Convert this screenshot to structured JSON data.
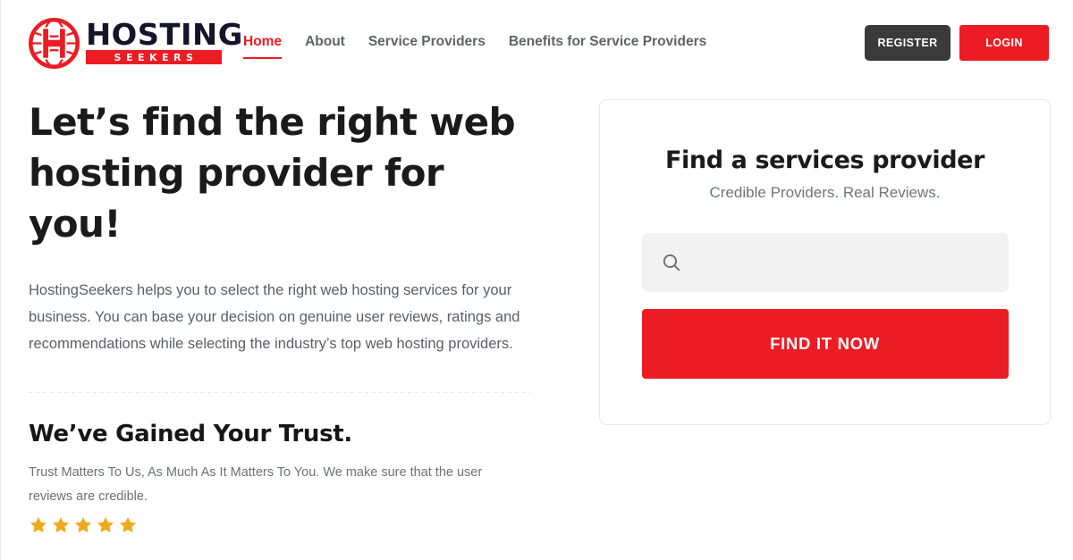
{
  "brand": {
    "logo_icon": "globe-h-logo",
    "name_top": "HOSTING",
    "name_bottom": "SEEKERS",
    "accent_color": "#ec1c24"
  },
  "nav": {
    "items": [
      {
        "label": "Home",
        "active": true
      },
      {
        "label": "About",
        "active": false
      },
      {
        "label": "Service Providers",
        "active": false
      },
      {
        "label": "Benefits for Service Providers",
        "active": false
      }
    ]
  },
  "header_actions": {
    "register_label": "REGISTER",
    "register_color": "#3a3a3a",
    "login_label": "LOGIN",
    "login_color": "#ec1c24"
  },
  "hero": {
    "title": "Let’s find the right web hosting provider for you!",
    "paragraph": "HostingSeekers helps you to select the right web hosting services for your business. You can base your decision on genuine user reviews, ratings and recommendations while selecting the industry’s top web hosting providers."
  },
  "trust": {
    "title": "We’ve Gained Your Trust.",
    "paragraph": "Trust Matters To Us, As Much As It Matters To You. We make sure that the user reviews are credible.",
    "rating": 5,
    "star_count": 5,
    "star_color": "#f0a81c",
    "star_icon": "star-icon"
  },
  "search_card": {
    "title": "Find a services provider",
    "subtitle": "Credible Providers. Real Reviews.",
    "search_icon": "search-icon",
    "search_value": "",
    "search_placeholder": "",
    "submit_label": "FIND IT NOW",
    "submit_color": "#ec1c24",
    "field_background": "#f2f2f2"
  }
}
